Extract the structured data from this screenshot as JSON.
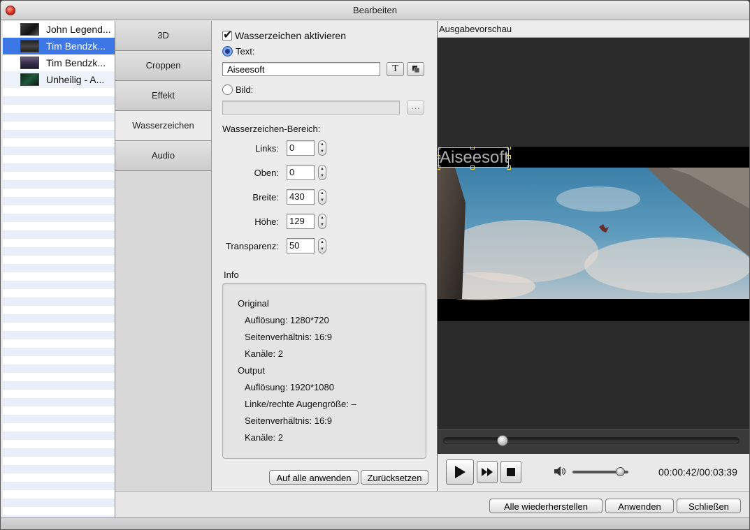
{
  "window": {
    "title": "Bearbeiten"
  },
  "files": [
    {
      "name": "John Legend..."
    },
    {
      "name": "Tim Bendzk..."
    },
    {
      "name": "Tim Bendzk..."
    },
    {
      "name": "Unheilig - A..."
    }
  ],
  "tabs": [
    "3D",
    "Croppen",
    "Effekt",
    "Wasserzeichen",
    "Audio"
  ],
  "active_tab": "Wasserzeichen",
  "watermark": {
    "enable_label": "Wasserzeichen aktivieren",
    "enabled": true,
    "text_option_label": "Text:",
    "text_value": "Aiseesoft",
    "text_style_icon": "T",
    "text_copy_icon": "copy-icon",
    "image_option_label": "Bild:",
    "image_value": "",
    "browse_label": "···",
    "area_label": "Wasserzeichen-Bereich:",
    "fields": [
      {
        "label": "Links:",
        "value": "0"
      },
      {
        "label": "Oben:",
        "value": "0"
      },
      {
        "label": "Breite:",
        "value": "430"
      },
      {
        "label": "Höhe:",
        "value": "129"
      },
      {
        "label": "Transparenz:",
        "value": "50"
      }
    ]
  },
  "info": {
    "title": "Info",
    "original_heading": "Original",
    "original_resolution": "Auflösung: 1280*720",
    "original_aspect": "Seitenverhältnis: 16:9",
    "original_channels": "Kanäle: 2",
    "output_heading": "Output",
    "output_resolution": "Auflösung: 1920*1080",
    "output_eye_size": "Linke/rechte Augengröße: –",
    "output_aspect": "Seitenverhältnis: 16:9",
    "output_channels": "Kanäle: 2"
  },
  "actions": {
    "apply_all": "Auf alle anwenden",
    "reset": "Zurücksetzen"
  },
  "preview": {
    "title": "Ausgabevorschau",
    "watermark_text": "Aiseesoft",
    "seek_fraction": 0.2,
    "volume_fraction": 0.85,
    "timecode": "00:00:42/00:03:39"
  },
  "footer": {
    "restore_all": "Alle wiederherstellen",
    "apply": "Anwenden",
    "close": "Schließen"
  },
  "colors": {
    "selection": "#3d77e6",
    "watermark_box": "#e8d84a"
  }
}
